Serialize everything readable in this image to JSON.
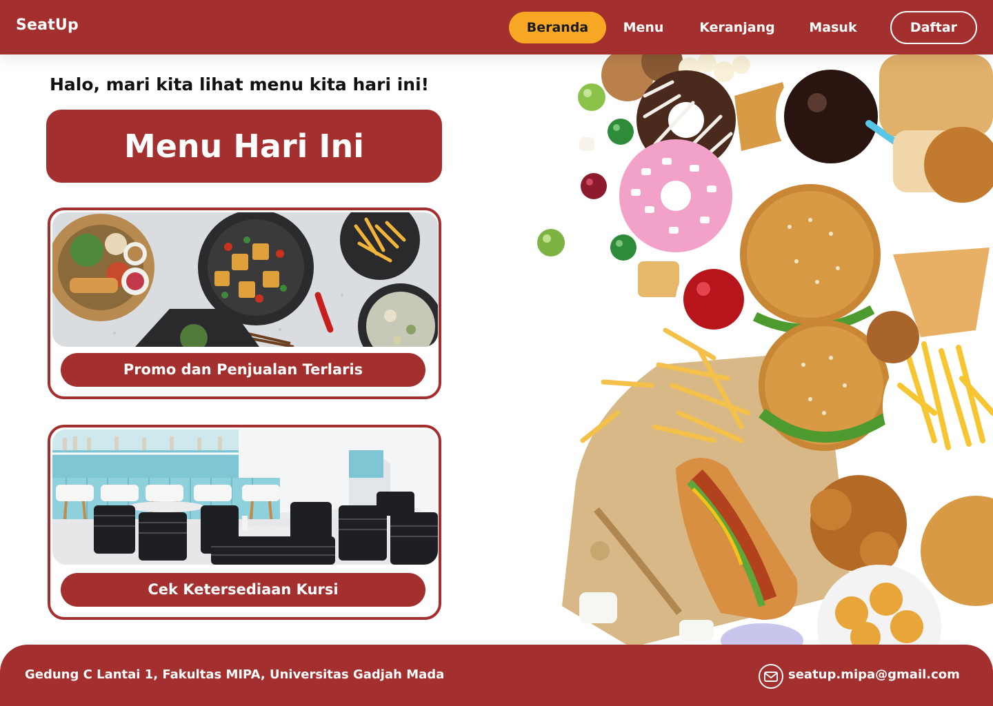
{
  "header": {
    "brand": "SeatUp",
    "nav": {
      "beranda": "Beranda",
      "menu": "Menu",
      "keranjang": "Keranjang",
      "masuk": "Masuk",
      "daftar": "Daftar"
    },
    "active_nav": "Beranda"
  },
  "main": {
    "greeting": "Halo, mari kita lihat menu kita hari ini!",
    "banner_title": "Menu Hari Ini",
    "cards": [
      {
        "image": "food-dishes-photo",
        "button_label": "Promo dan Penjualan Terlaris"
      },
      {
        "image": "cafe-seating-photo",
        "button_label": "Cek Ketersediaan Kursi"
      }
    ]
  },
  "hero": {
    "image": "fast-food-collage-photo"
  },
  "footer": {
    "address": "Gedung C Lantai 1, Fakultas MIPA, Universitas Gadjah Mada",
    "email": "seatup.mipa@gmail.com",
    "email_icon": "mail-icon"
  },
  "colors": {
    "primary": "#a3302e",
    "accent": "#f9a826",
    "background": "#ffffff",
    "text_dark": "#111111"
  }
}
